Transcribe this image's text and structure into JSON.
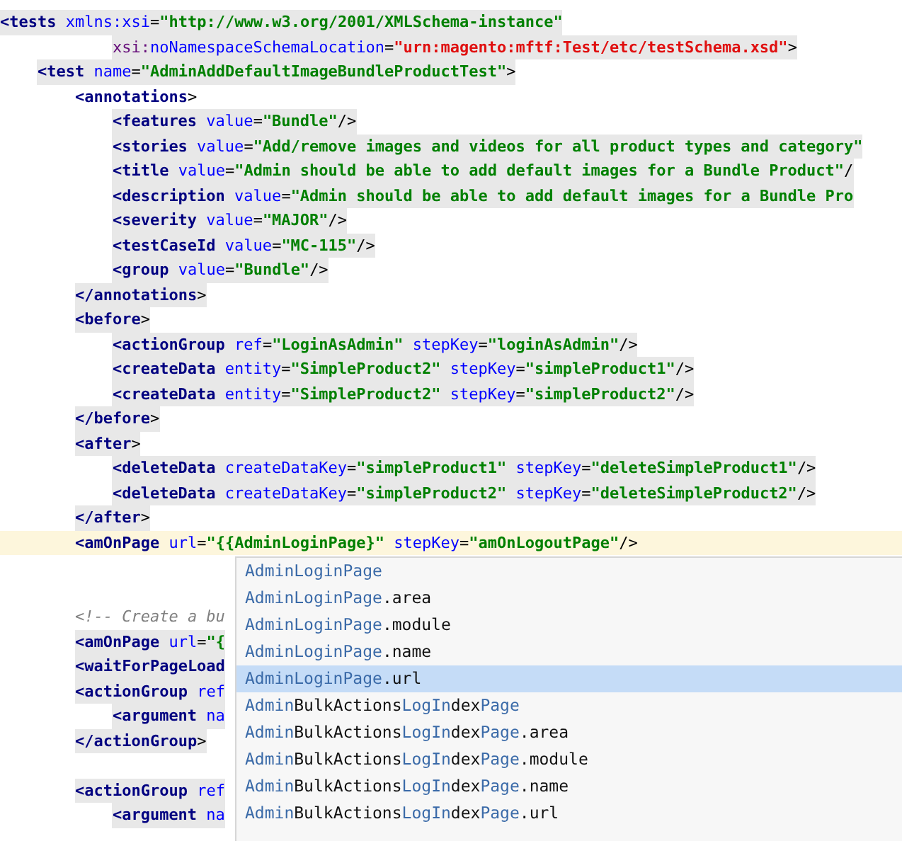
{
  "lines": [
    {
      "kind": "code",
      "highlighted": true,
      "current": false,
      "tokens": [
        {
          "kind": "tag",
          "t": "<tests"
        },
        {
          "kind": "attr",
          "t": " xmlns:xsi"
        },
        {
          "kind": "punct",
          "t": "="
        },
        {
          "kind": "value",
          "t": "\"http://www.w3.org/2001/XMLSchema-instance\""
        }
      ],
      "children": [
        {
          "kind": "continuation",
          "highlighted": true,
          "current": false,
          "tokens": [
            {
              "kind": "ns",
              "t": "xsi:"
            },
            {
              "kind": "attr",
              "t": "noNamespaceSchemaLocation"
            },
            {
              "kind": "punct",
              "t": "="
            },
            {
              "kind": "urn",
              "t": "\"urn:magento:mftf:Test/etc/testSchema.xsd\""
            },
            {
              "kind": "punct",
              "t": ">"
            }
          ]
        },
        {
          "kind": "code",
          "highlighted": true,
          "current": false,
          "tokens": [
            {
              "kind": "tag",
              "t": "<test"
            },
            {
              "kind": "attr",
              "t": " name"
            },
            {
              "kind": "punct",
              "t": "="
            },
            {
              "kind": "value",
              "t": "\"AdminAddDefaultImageBundleProductTest\""
            },
            {
              "kind": "punct",
              "t": ">"
            }
          ],
          "children": [
            {
              "kind": "code",
              "highlighted": false,
              "current": false,
              "tokens": [
                {
                  "kind": "tag",
                  "t": "<annotations"
                },
                {
                  "kind": "punct",
                  "t": ">"
                }
              ],
              "children": [
                {
                  "kind": "code",
                  "highlighted": true,
                  "current": false,
                  "tokens": [
                    {
                      "kind": "tag",
                      "t": "<features"
                    },
                    {
                      "kind": "attr",
                      "t": " value"
                    },
                    {
                      "kind": "punct",
                      "t": "="
                    },
                    {
                      "kind": "value",
                      "t": "\"Bundle\""
                    },
                    {
                      "kind": "punct",
                      "t": "/>"
                    }
                  ]
                },
                {
                  "kind": "code",
                  "highlighted": true,
                  "current": false,
                  "tokens": [
                    {
                      "kind": "tag",
                      "t": "<stories"
                    },
                    {
                      "kind": "attr",
                      "t": " value"
                    },
                    {
                      "kind": "punct",
                      "t": "="
                    },
                    {
                      "kind": "value",
                      "t": "\"Add/remove images and videos for all product types and category\""
                    }
                  ]
                },
                {
                  "kind": "code",
                  "highlighted": true,
                  "current": false,
                  "tokens": [
                    {
                      "kind": "tag",
                      "t": "<title"
                    },
                    {
                      "kind": "attr",
                      "t": " value"
                    },
                    {
                      "kind": "punct",
                      "t": "="
                    },
                    {
                      "kind": "value",
                      "t": "\"Admin should be able to add default images for a Bundle Product\""
                    },
                    {
                      "kind": "punct",
                      "t": "/"
                    }
                  ]
                },
                {
                  "kind": "code",
                  "highlighted": true,
                  "current": false,
                  "tokens": [
                    {
                      "kind": "tag",
                      "t": "<description"
                    },
                    {
                      "kind": "attr",
                      "t": " value"
                    },
                    {
                      "kind": "punct",
                      "t": "="
                    },
                    {
                      "kind": "value",
                      "t": "\"Admin should be able to add default images for a Bundle Pro"
                    }
                  ]
                },
                {
                  "kind": "code",
                  "highlighted": true,
                  "current": false,
                  "tokens": [
                    {
                      "kind": "tag",
                      "t": "<severity"
                    },
                    {
                      "kind": "attr",
                      "t": " value"
                    },
                    {
                      "kind": "punct",
                      "t": "="
                    },
                    {
                      "kind": "value",
                      "t": "\"MAJOR\""
                    },
                    {
                      "kind": "punct",
                      "t": "/>"
                    }
                  ]
                },
                {
                  "kind": "code",
                  "highlighted": true,
                  "current": false,
                  "tokens": [
                    {
                      "kind": "tag",
                      "t": "<testCaseId"
                    },
                    {
                      "kind": "attr",
                      "t": " value"
                    },
                    {
                      "kind": "punct",
                      "t": "="
                    },
                    {
                      "kind": "value",
                      "t": "\"MC-115\""
                    },
                    {
                      "kind": "punct",
                      "t": "/>"
                    }
                  ]
                },
                {
                  "kind": "code",
                  "highlighted": true,
                  "current": false,
                  "tokens": [
                    {
                      "kind": "tag",
                      "t": "<group"
                    },
                    {
                      "kind": "attr",
                      "t": " value"
                    },
                    {
                      "kind": "punct",
                      "t": "="
                    },
                    {
                      "kind": "value",
                      "t": "\"Bundle\""
                    },
                    {
                      "kind": "punct",
                      "t": "/>"
                    }
                  ]
                }
              ]
            },
            {
              "kind": "code",
              "highlighted": true,
              "current": false,
              "tokens": [
                {
                  "kind": "tag",
                  "t": "</annotations"
                },
                {
                  "kind": "punct",
                  "t": ">"
                }
              ]
            },
            {
              "kind": "code",
              "highlighted": true,
              "current": false,
              "tokens": [
                {
                  "kind": "tag",
                  "t": "<before"
                },
                {
                  "kind": "punct",
                  "t": ">"
                }
              ],
              "children": [
                {
                  "kind": "code",
                  "highlighted": true,
                  "current": false,
                  "tokens": [
                    {
                      "kind": "tag",
                      "t": "<actionGroup"
                    },
                    {
                      "kind": "attr",
                      "t": " ref"
                    },
                    {
                      "kind": "punct",
                      "t": "="
                    },
                    {
                      "kind": "value",
                      "t": "\"LoginAsAdmin\""
                    },
                    {
                      "kind": "attr",
                      "t": " stepKey"
                    },
                    {
                      "kind": "punct",
                      "t": "="
                    },
                    {
                      "kind": "value",
                      "t": "\"loginAsAdmin\""
                    },
                    {
                      "kind": "punct",
                      "t": "/>"
                    }
                  ]
                },
                {
                  "kind": "code",
                  "highlighted": true,
                  "current": false,
                  "tokens": [
                    {
                      "kind": "tag",
                      "t": "<createData"
                    },
                    {
                      "kind": "attr",
                      "t": " entity"
                    },
                    {
                      "kind": "punct",
                      "t": "="
                    },
                    {
                      "kind": "value",
                      "t": "\"SimpleProduct2\""
                    },
                    {
                      "kind": "attr",
                      "t": " stepKey"
                    },
                    {
                      "kind": "punct",
                      "t": "="
                    },
                    {
                      "kind": "value",
                      "t": "\"simpleProduct1\""
                    },
                    {
                      "kind": "punct",
                      "t": "/>"
                    }
                  ]
                },
                {
                  "kind": "code",
                  "highlighted": true,
                  "current": false,
                  "tokens": [
                    {
                      "kind": "tag",
                      "t": "<createData"
                    },
                    {
                      "kind": "attr",
                      "t": " entity"
                    },
                    {
                      "kind": "punct",
                      "t": "="
                    },
                    {
                      "kind": "value",
                      "t": "\"SimpleProduct2\""
                    },
                    {
                      "kind": "attr",
                      "t": " stepKey"
                    },
                    {
                      "kind": "punct",
                      "t": "="
                    },
                    {
                      "kind": "value",
                      "t": "\"simpleProduct2\""
                    },
                    {
                      "kind": "punct",
                      "t": "/>"
                    }
                  ]
                }
              ]
            },
            {
              "kind": "code",
              "highlighted": true,
              "current": false,
              "tokens": [
                {
                  "kind": "tag",
                  "t": "</before"
                },
                {
                  "kind": "punct",
                  "t": ">"
                }
              ]
            },
            {
              "kind": "code",
              "highlighted": true,
              "current": false,
              "tokens": [
                {
                  "kind": "tag",
                  "t": "<after"
                },
                {
                  "kind": "punct",
                  "t": ">"
                }
              ],
              "children": [
                {
                  "kind": "code",
                  "highlighted": true,
                  "current": false,
                  "tokens": [
                    {
                      "kind": "tag",
                      "t": "<deleteData"
                    },
                    {
                      "kind": "attr",
                      "t": " createDataKey"
                    },
                    {
                      "kind": "punct",
                      "t": "="
                    },
                    {
                      "kind": "value",
                      "t": "\"simpleProduct1\""
                    },
                    {
                      "kind": "attr",
                      "t": " stepKey"
                    },
                    {
                      "kind": "punct",
                      "t": "="
                    },
                    {
                      "kind": "value",
                      "t": "\"deleteSimpleProduct1\""
                    },
                    {
                      "kind": "punct",
                      "t": "/>"
                    }
                  ]
                },
                {
                  "kind": "code",
                  "highlighted": true,
                  "current": false,
                  "tokens": [
                    {
                      "kind": "tag",
                      "t": "<deleteData"
                    },
                    {
                      "kind": "attr",
                      "t": " createDataKey"
                    },
                    {
                      "kind": "punct",
                      "t": "="
                    },
                    {
                      "kind": "value",
                      "t": "\"simpleProduct2\""
                    },
                    {
                      "kind": "attr",
                      "t": " stepKey"
                    },
                    {
                      "kind": "punct",
                      "t": "="
                    },
                    {
                      "kind": "value",
                      "t": "\"deleteSimpleProduct2\""
                    },
                    {
                      "kind": "punct",
                      "t": "/>"
                    }
                  ]
                }
              ]
            },
            {
              "kind": "code",
              "highlighted": true,
              "current": false,
              "tokens": [
                {
                  "kind": "tag",
                  "t": "</after"
                },
                {
                  "kind": "punct",
                  "t": ">"
                }
              ]
            },
            {
              "kind": "code",
              "highlighted": false,
              "current": true,
              "tokens": [
                {
                  "kind": "tag",
                  "t": "<amOnPage"
                },
                {
                  "kind": "attr",
                  "t": " url"
                },
                {
                  "kind": "punct",
                  "t": "="
                },
                {
                  "kind": "value",
                  "t": "\"{{AdminLoginPage}\""
                },
                {
                  "kind": "attr",
                  "t": " stepKey"
                },
                {
                  "kind": "punct",
                  "t": "="
                },
                {
                  "kind": "value",
                  "t": "\"amOnLogoutPage\""
                },
                {
                  "kind": "punct",
                  "t": "/>"
                }
              ]
            },
            {
              "kind": "blank"
            },
            {
              "kind": "blank"
            },
            {
              "kind": "comment",
              "highlighted": false,
              "current": false,
              "tokens": [
                {
                  "kind": "comment",
                  "t": "<!-- Create a bu"
                }
              ]
            },
            {
              "kind": "code",
              "highlighted": true,
              "current": false,
              "tokens": [
                {
                  "kind": "tag",
                  "t": "<amOnPage"
                },
                {
                  "kind": "attr",
                  "t": " url"
                },
                {
                  "kind": "punct",
                  "t": "="
                },
                {
                  "kind": "value",
                  "t": "\"{"
                }
              ]
            },
            {
              "kind": "code",
              "highlighted": true,
              "current": false,
              "tokens": [
                {
                  "kind": "tag",
                  "t": "<waitForPageLoad"
                }
              ]
            },
            {
              "kind": "code",
              "highlighted": true,
              "current": false,
              "tokens": [
                {
                  "kind": "tag",
                  "t": "<actionGroup"
                },
                {
                  "kind": "attr",
                  "t": " ref"
                }
              ],
              "children": [
                {
                  "kind": "code",
                  "highlighted": true,
                  "current": false,
                  "tokens": [
                    {
                      "kind": "tag",
                      "t": "<argument"
                    },
                    {
                      "kind": "attr",
                      "t": " na"
                    }
                  ]
                }
              ]
            },
            {
              "kind": "code",
              "highlighted": true,
              "current": false,
              "tokens": [
                {
                  "kind": "tag",
                  "t": "</actionGroup"
                },
                {
                  "kind": "punct",
                  "t": ">"
                }
              ]
            },
            {
              "kind": "blank"
            },
            {
              "kind": "code",
              "highlighted": true,
              "current": false,
              "tokens": [
                {
                  "kind": "tag",
                  "t": "<actionGroup"
                },
                {
                  "kind": "attr",
                  "t": " ref"
                }
              ],
              "children": [
                {
                  "kind": "code",
                  "highlighted": true,
                  "current": false,
                  "tokens": [
                    {
                      "kind": "tag",
                      "t": "<argument"
                    },
                    {
                      "kind": "attr",
                      "t": " na"
                    }
                  ]
                }
              ]
            }
          ]
        }
      ]
    }
  ],
  "completion": {
    "items": [
      {
        "selected": false,
        "parts": [
          {
            "kind": "match",
            "t": "AdminLoginPage"
          }
        ]
      },
      {
        "selected": false,
        "parts": [
          {
            "kind": "match",
            "t": "AdminLoginPage"
          },
          {
            "kind": "plain",
            "t": ".area"
          }
        ]
      },
      {
        "selected": false,
        "parts": [
          {
            "kind": "match",
            "t": "AdminLoginPage"
          },
          {
            "kind": "plain",
            "t": ".module"
          }
        ]
      },
      {
        "selected": false,
        "parts": [
          {
            "kind": "match",
            "t": "AdminLoginPage"
          },
          {
            "kind": "plain",
            "t": ".name"
          }
        ]
      },
      {
        "selected": true,
        "parts": [
          {
            "kind": "match",
            "t": "AdminLoginPage"
          },
          {
            "kind": "plain",
            "t": ".url"
          }
        ]
      },
      {
        "selected": false,
        "parts": [
          {
            "kind": "match",
            "t": "Admin"
          },
          {
            "kind": "plain",
            "t": "BulkActions"
          },
          {
            "kind": "match",
            "t": "LogIn"
          },
          {
            "kind": "plain",
            "t": "dex"
          },
          {
            "kind": "match",
            "t": "Page"
          }
        ]
      },
      {
        "selected": false,
        "parts": [
          {
            "kind": "match",
            "t": "Admin"
          },
          {
            "kind": "plain",
            "t": "BulkActions"
          },
          {
            "kind": "match",
            "t": "LogIn"
          },
          {
            "kind": "plain",
            "t": "dex"
          },
          {
            "kind": "match",
            "t": "Page"
          },
          {
            "kind": "plain",
            "t": ".area"
          }
        ]
      },
      {
        "selected": false,
        "parts": [
          {
            "kind": "match",
            "t": "Admin"
          },
          {
            "kind": "plain",
            "t": "BulkActions"
          },
          {
            "kind": "match",
            "t": "LogIn"
          },
          {
            "kind": "plain",
            "t": "dex"
          },
          {
            "kind": "match",
            "t": "Page"
          },
          {
            "kind": "plain",
            "t": ".module"
          }
        ]
      },
      {
        "selected": false,
        "parts": [
          {
            "kind": "match",
            "t": "Admin"
          },
          {
            "kind": "plain",
            "t": "BulkActions"
          },
          {
            "kind": "match",
            "t": "LogIn"
          },
          {
            "kind": "plain",
            "t": "dex"
          },
          {
            "kind": "match",
            "t": "Page"
          },
          {
            "kind": "plain",
            "t": ".name"
          }
        ]
      },
      {
        "selected": false,
        "parts": [
          {
            "kind": "match",
            "t": "Admin"
          },
          {
            "kind": "plain",
            "t": "BulkActions"
          },
          {
            "kind": "match",
            "t": "LogIn"
          },
          {
            "kind": "plain",
            "t": "dex"
          },
          {
            "kind": "match",
            "t": "Page"
          },
          {
            "kind": "plain",
            "t": ".url"
          }
        ]
      }
    ]
  }
}
